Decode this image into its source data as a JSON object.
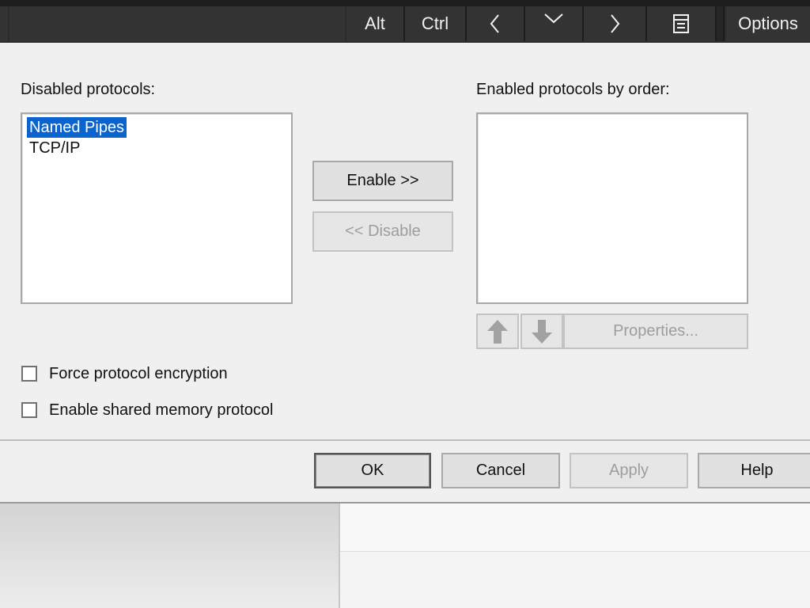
{
  "toolbar": {
    "alt_label": "Alt",
    "ctrl_label": "Ctrl",
    "options_label": "Options",
    "icons": [
      "chevron-left-icon",
      "chevron-down-icon",
      "chevron-right-icon",
      "document-icon"
    ]
  },
  "dialog": {
    "disabled_label": "Disabled protocols:",
    "enabled_label": "Enabled protocols by order:",
    "disabled_protocols": [
      "Named Pipes",
      "TCP/IP"
    ],
    "selected_protocol": "Named Pipes",
    "enabled_protocols": [],
    "enable_button": "Enable >>",
    "disable_button": "<< Disable",
    "properties_button": "Properties...",
    "force_encryption_label": "Force protocol encryption",
    "force_encryption_checked": false,
    "shared_memory_label": "Enable shared memory protocol",
    "shared_memory_checked": false,
    "ok_button": "OK",
    "cancel_button": "Cancel",
    "apply_button": "Apply",
    "help_button": "Help",
    "colors": {
      "selection": "#0a64d0",
      "dialog_bg": "#f0f0f0",
      "toolbar_bg": "#333333"
    }
  }
}
